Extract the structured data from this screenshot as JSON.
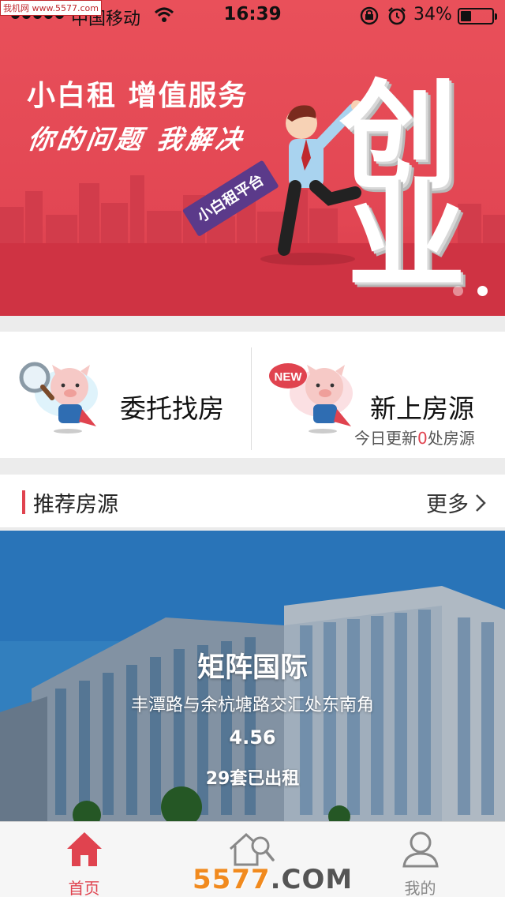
{
  "watermark_top": "我机网 www.5577.com",
  "status_bar": {
    "carrier": "中国移动",
    "time": "16:39",
    "battery": "34%",
    "battery_level": 0.34
  },
  "banner": {
    "title": "小白租  增值服务",
    "subtitle": "你的问题  我解决",
    "big_char_1": "创",
    "big_char_2": "业",
    "flag_text": "小白租平台",
    "page_count": 2,
    "active_page": 2
  },
  "quick_entries": [
    {
      "label": "委托找房",
      "icon": "search-pig-icon"
    },
    {
      "label": "新上房源",
      "icon": "new-pig-icon",
      "sub_prefix": "今日更新",
      "sub_count": "0",
      "sub_suffix": "处房源",
      "badge": "NEW"
    }
  ],
  "section": {
    "title": "推荐房源",
    "more": "更多"
  },
  "property": {
    "name": "矩阵国际",
    "address": "丰潭路与余杭塘路交汇处东南角",
    "price": "4.56",
    "rented": "29套已出租"
  },
  "tabs": [
    {
      "label": "首页",
      "icon": "home-icon",
      "active": true
    },
    {
      "label": "",
      "icon": "house-search-icon",
      "active": false
    },
    {
      "label": "我的",
      "icon": "user-icon",
      "active": false
    }
  ],
  "watermark_bottom": {
    "a": "5577",
    "b": ".COM"
  },
  "colors": {
    "accent": "#e0434f",
    "banner": "#e24653"
  }
}
